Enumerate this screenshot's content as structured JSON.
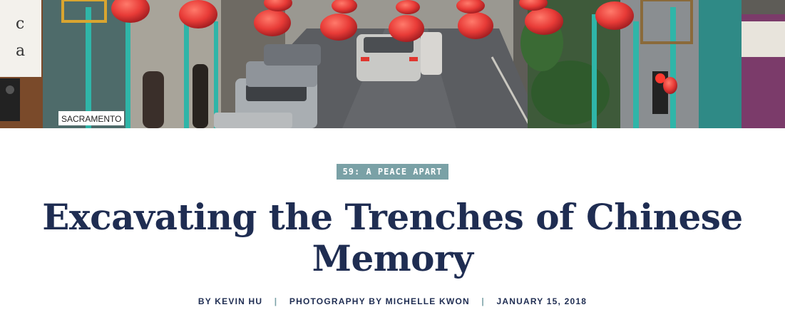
{
  "hero": {
    "alt": "Street scene with red lanterns",
    "shop_sign_letters": [
      "c",
      "a"
    ],
    "street_sign_text": "SACRAMENTO"
  },
  "badge": {
    "label": "59: A PEACE APART"
  },
  "article": {
    "title_line1": "Excavating the Trenches of Chinese",
    "title_line2": "Memory"
  },
  "byline": {
    "author": "BY KEVIN HU",
    "photography": "PHOTOGRAPHY BY MICHELLE KWON",
    "date": "JANUARY 15, 2018",
    "separator": "|"
  },
  "colors": {
    "title": "#1f2d52",
    "badge_bg": "#7aa1a6",
    "lantern": "#e83b37"
  }
}
